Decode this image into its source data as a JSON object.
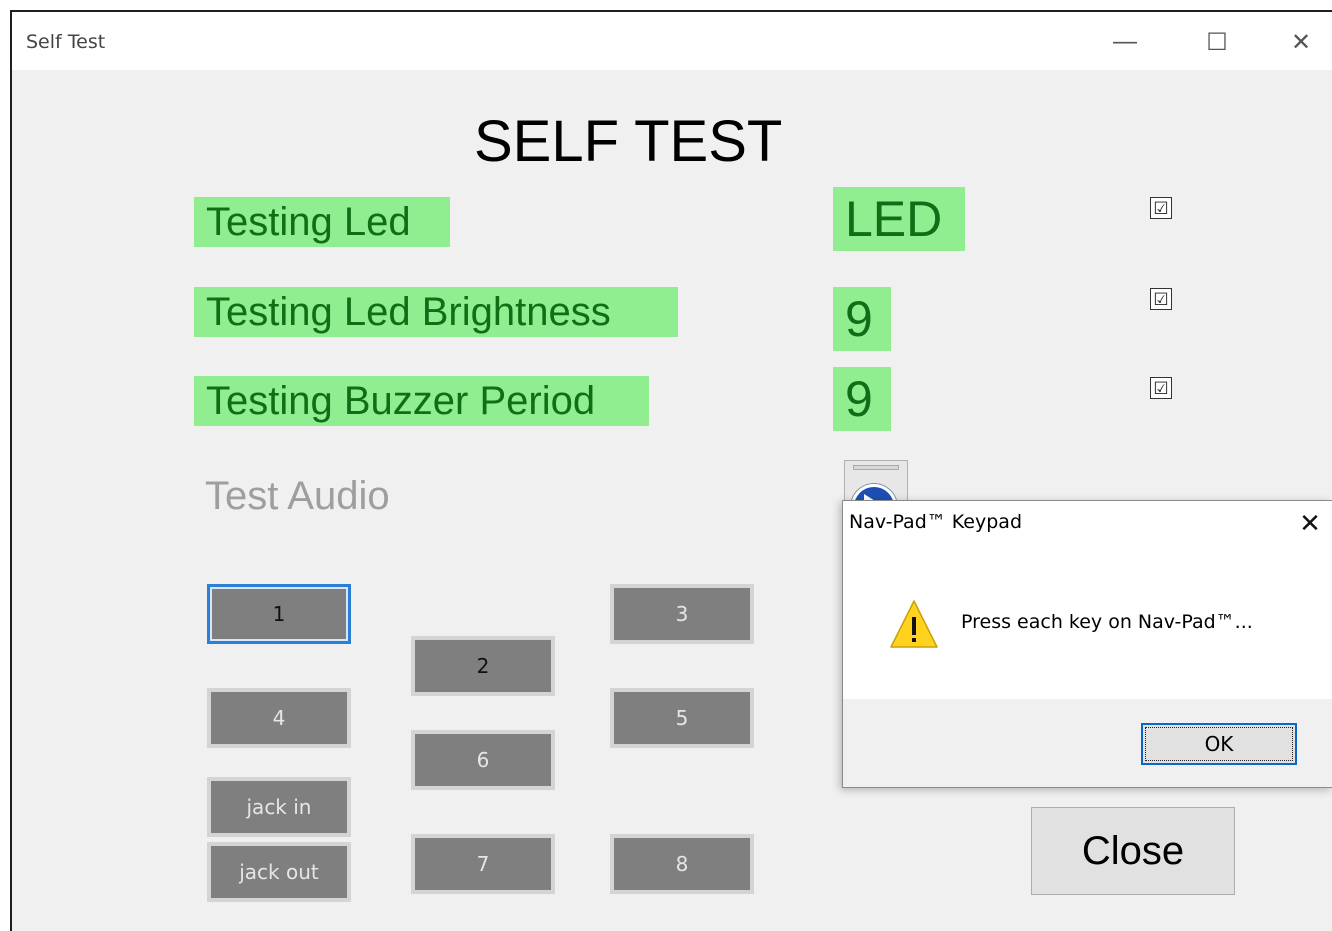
{
  "window": {
    "title": "Self Test",
    "controls": {
      "minimize": "—",
      "maximize": "☐",
      "close": "✕"
    }
  },
  "heading": "SELF TEST",
  "tests": [
    {
      "label": "Testing Led",
      "value": "LED",
      "checked": "☑"
    },
    {
      "label": "Testing Led Brightness",
      "value": "9",
      "checked": "☑"
    },
    {
      "label": "Testing Buzzer Period",
      "value": "9",
      "checked": "☑"
    }
  ],
  "audio": {
    "label": "Test Audio",
    "play_icon": "play-circle-icon"
  },
  "keys": [
    "1",
    "2",
    "3",
    "4",
    "5",
    "6",
    "jack in",
    "jack out",
    "7",
    "8"
  ],
  "close_label": "Close",
  "dialog": {
    "title": "Nav-Pad™ Keypad",
    "close": "✕",
    "icon": "warning-icon",
    "message": "Press each key  on Nav-Pad™...",
    "ok_label": "OK"
  },
  "colors": {
    "label_bg": "#90ee90",
    "label_text": "#0f6e16",
    "key_bg": "#7f7f7f",
    "accent": "#0a67c7"
  }
}
